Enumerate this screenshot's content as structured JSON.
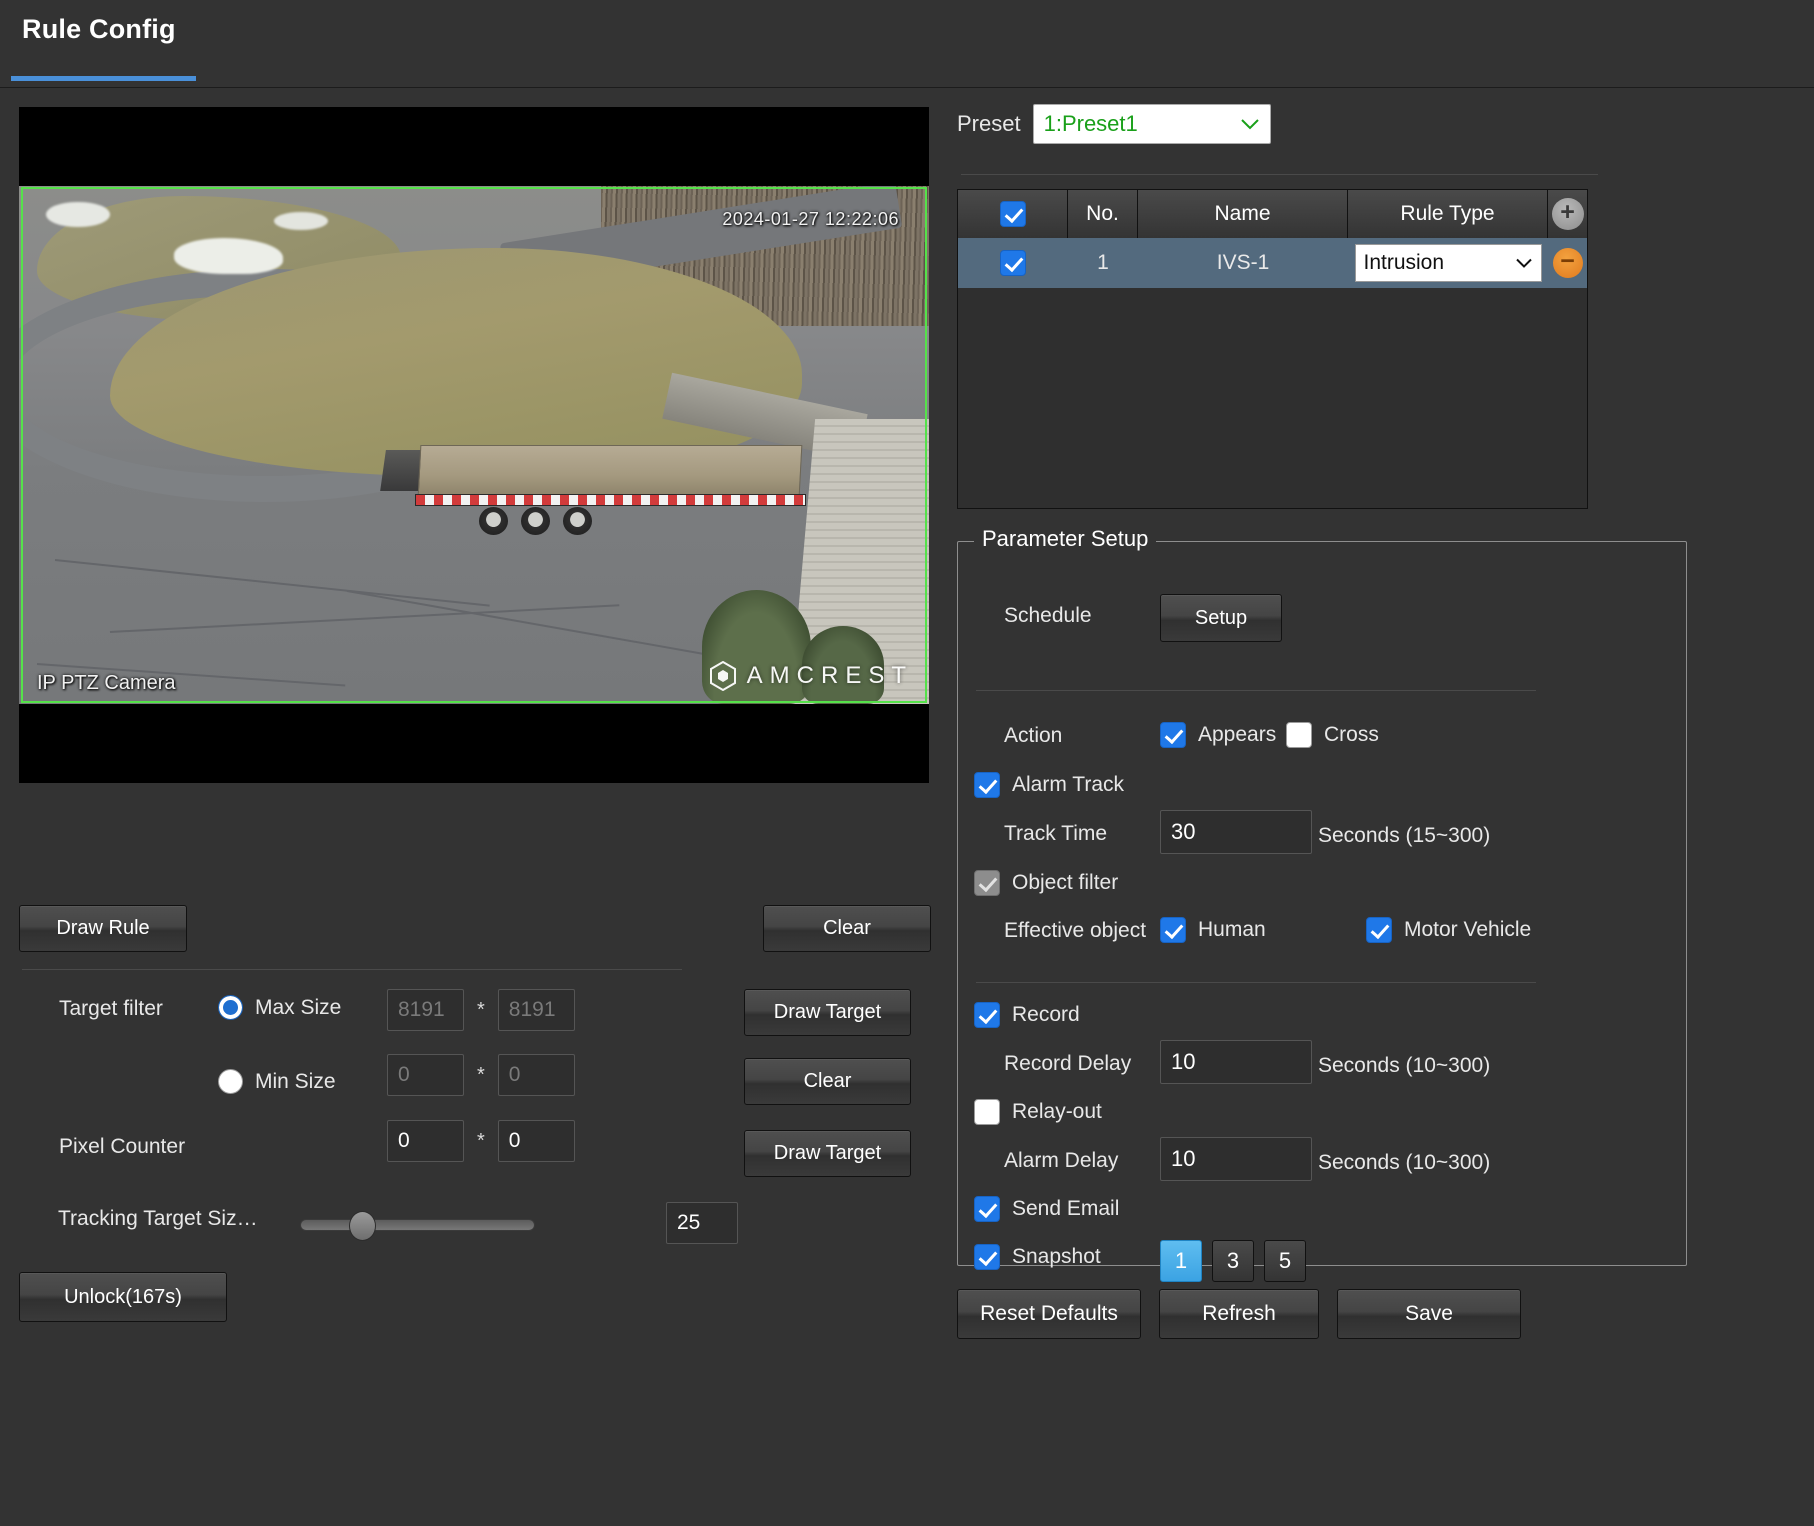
{
  "header": {
    "title": "Rule Config"
  },
  "video": {
    "timestamp": "2024-01-27 12:22:06",
    "camera_name": "IP PTZ Camera",
    "brand": "AMCREST",
    "rule_boundary_color": "#55e24a"
  },
  "left_panel": {
    "draw_rule_label": "Draw Rule",
    "clear_rule_label": "Clear",
    "target_filter_label": "Target filter",
    "max_size_label": "Max Size",
    "min_size_label": "Min Size",
    "pixel_counter_label": "Pixel Counter",
    "max_size_width": "8191",
    "max_size_height": "8191",
    "min_size_width": "0",
    "min_size_height": "0",
    "pixel_counter_width": "0",
    "pixel_counter_height": "0",
    "multiply_symbol": "*",
    "draw_target_label_1": "Draw Target",
    "clear_target_label": "Clear",
    "draw_target_label_2": "Draw Target",
    "tracking_target_size_label": "Tracking Target Siz…",
    "tracking_target_size_value": "25",
    "unlock_label": "Unlock(167s)"
  },
  "right_panel": {
    "preset_label": "Preset",
    "preset_value": "1:Preset1",
    "table": {
      "columns": [
        "",
        "No.",
        "Name",
        "Rule Type",
        ""
      ],
      "header_select_all_checked": true,
      "add_icon": "+",
      "rows": [
        {
          "checked": true,
          "no": "1",
          "name": "IVS-1",
          "rule_type": "Intrusion",
          "delete_icon": "−"
        }
      ]
    },
    "parameter_setup": {
      "legend": "Parameter Setup",
      "schedule_label": "Schedule",
      "setup_button": "Setup",
      "action_label": "Action",
      "appears_label": "Appears",
      "appears_checked": true,
      "cross_label": "Cross",
      "cross_checked": false,
      "alarm_track_label": "Alarm Track",
      "alarm_track_checked": true,
      "track_time_label": "Track Time",
      "track_time_value": "30",
      "track_time_unit": "Seconds (15~300)",
      "object_filter_label": "Object filter",
      "object_filter_checked": true,
      "object_filter_disabled": true,
      "effective_object_label": "Effective object",
      "human_label": "Human",
      "human_checked": true,
      "motor_vehicle_label": "Motor Vehicle",
      "motor_vehicle_checked": true,
      "record_label": "Record",
      "record_checked": true,
      "record_delay_label": "Record Delay",
      "record_delay_value": "10",
      "record_delay_unit": "Seconds (10~300)",
      "relay_out_label": "Relay-out",
      "relay_out_checked": false,
      "alarm_delay_label": "Alarm Delay",
      "alarm_delay_value": "10",
      "alarm_delay_unit": "Seconds (10~300)",
      "send_email_label": "Send Email",
      "send_email_checked": true,
      "snapshot_label": "Snapshot",
      "snapshot_checked": true,
      "snapshot_options": [
        "1",
        "3",
        "5"
      ],
      "snapshot_selected": "1"
    },
    "reset_defaults_label": "Reset Defaults",
    "refresh_label": "Refresh",
    "save_label": "Save"
  },
  "colors": {
    "accent_blue": "#4a90d9",
    "checkbox_blue": "#1f78e8",
    "row_selected": "#536a7e",
    "preset_text_green": "#1aa01a",
    "delete_orange": "#e07a1e"
  }
}
